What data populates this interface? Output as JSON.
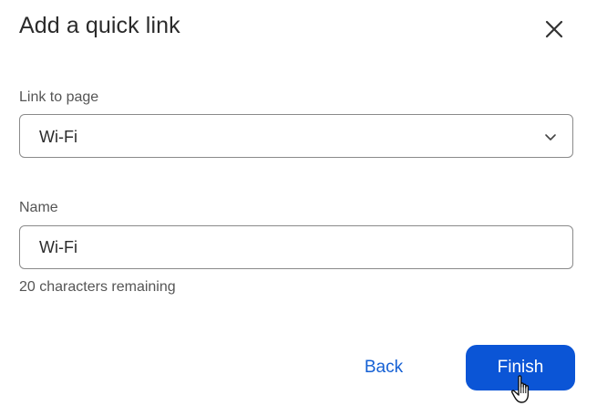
{
  "dialog": {
    "title": "Add a quick link",
    "close_icon": "close-icon"
  },
  "link_to_page": {
    "label": "Link to page",
    "selected_value": "Wi-Fi",
    "chevron_icon": "chevron-down-icon"
  },
  "name": {
    "label": "Name",
    "value": "Wi-Fi",
    "helper": "20 characters remaining"
  },
  "actions": {
    "back_label": "Back",
    "finish_label": "Finish"
  },
  "colors": {
    "primary": "#0b55d6",
    "link": "#1560d4",
    "border": "#8a8a8a",
    "text": "#2b2b2b",
    "muted": "#555555"
  },
  "cursor_icon": "hand-pointer-icon"
}
